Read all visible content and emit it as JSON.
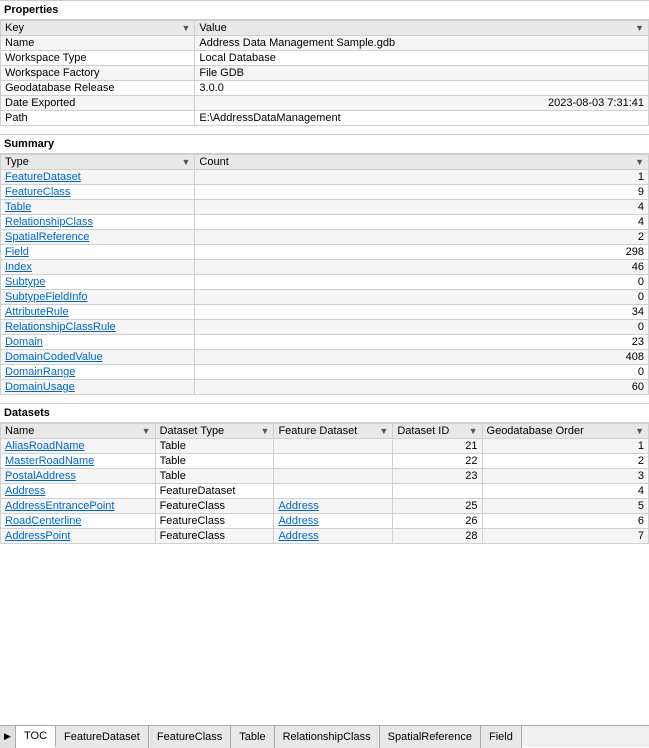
{
  "title": "Properties",
  "properties_table": {
    "col1_header": "Key",
    "col2_header": "Value",
    "rows": [
      {
        "key": "Name",
        "value": "Address Data Management Sample.gdb"
      },
      {
        "key": "Workspace Type",
        "value": "Local Database"
      },
      {
        "key": "Workspace Factory",
        "value": "File GDB"
      },
      {
        "key": "Geodatabase Release",
        "value": "3.0.0"
      },
      {
        "key": "Date Exported",
        "value": "2023-08-03 7:31:41",
        "align_right": true
      },
      {
        "key": "Path",
        "value": "E:\\AddressDataManagement"
      }
    ]
  },
  "summary_section": {
    "title": "Summary",
    "col1_header": "Type",
    "col2_header": "Count",
    "rows": [
      {
        "type": "FeatureDataset",
        "count": "1",
        "is_link": true
      },
      {
        "type": "FeatureClass",
        "count": "9",
        "is_link": true
      },
      {
        "type": "Table",
        "count": "4",
        "is_link": true
      },
      {
        "type": "RelationshipClass",
        "count": "4",
        "is_link": true
      },
      {
        "type": "SpatialReference",
        "count": "2",
        "is_link": true
      },
      {
        "type": "Field",
        "count": "298",
        "is_link": true
      },
      {
        "type": "Index",
        "count": "46",
        "is_link": true
      },
      {
        "type": "Subtype",
        "count": "0",
        "is_link": true
      },
      {
        "type": "SubtypeFieldInfo",
        "count": "0",
        "is_link": true
      },
      {
        "type": "AttributeRule",
        "count": "34",
        "is_link": true
      },
      {
        "type": "RelationshipClassRule",
        "count": "0",
        "is_link": true
      },
      {
        "type": "Domain",
        "count": "23",
        "is_link": true
      },
      {
        "type": "DomainCodedValue",
        "count": "408",
        "is_link": true
      },
      {
        "type": "DomainRange",
        "count": "0",
        "is_link": true
      },
      {
        "type": "DomainUsage",
        "count": "60",
        "is_link": true
      }
    ]
  },
  "datasets_section": {
    "title": "Datasets",
    "headers": {
      "name": "Name",
      "dataset_type": "Dataset Type",
      "feature_dataset": "Feature Dataset",
      "dataset_id": "Dataset ID",
      "geodatabase_order": "Geodatabase Order"
    },
    "rows": [
      {
        "name": "AliasRoadName",
        "is_link": true,
        "dataset_type": "Table",
        "feature_dataset": "",
        "fd_link": false,
        "dataset_id": "21",
        "order": "1"
      },
      {
        "name": "MasterRoadName",
        "is_link": true,
        "dataset_type": "Table",
        "feature_dataset": "",
        "fd_link": false,
        "dataset_id": "22",
        "order": "2"
      },
      {
        "name": "PostalAddress",
        "is_link": true,
        "dataset_type": "Table",
        "feature_dataset": "",
        "fd_link": false,
        "dataset_id": "23",
        "order": "3"
      },
      {
        "name": "Address",
        "is_link": true,
        "dataset_type": "FeatureDataset",
        "feature_dataset": "",
        "fd_link": false,
        "dataset_id": "",
        "order": "4"
      },
      {
        "name": "AddressEntrancePoint",
        "is_link": true,
        "dataset_type": "FeatureClass",
        "feature_dataset": "Address",
        "fd_link": true,
        "dataset_id": "25",
        "order": "5"
      },
      {
        "name": "RoadCenterline",
        "is_link": true,
        "dataset_type": "FeatureClass",
        "feature_dataset": "Address",
        "fd_link": true,
        "dataset_id": "26",
        "order": "6"
      },
      {
        "name": "AddressPoint",
        "is_link": true,
        "dataset_type": "FeatureClass",
        "feature_dataset": "Address",
        "fd_link": true,
        "dataset_id": "28",
        "order": "7"
      }
    ]
  },
  "bottom_tabs": {
    "arrow_label": "▶",
    "tabs": [
      {
        "label": "TOC",
        "active": true
      },
      {
        "label": "FeatureDataset",
        "active": false
      },
      {
        "label": "FeatureClass",
        "active": false
      },
      {
        "label": "Table",
        "active": false
      },
      {
        "label": "RelationshipClass",
        "active": false
      },
      {
        "label": "SpatialReference",
        "active": false
      },
      {
        "label": "Field",
        "active": false
      }
    ]
  }
}
